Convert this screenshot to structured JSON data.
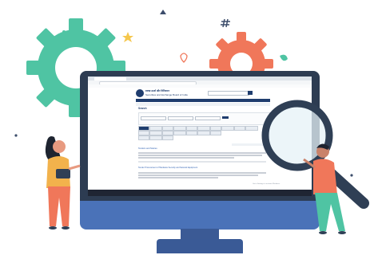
{
  "website": {
    "logo_text_line1": "स्वच्छ ऊर्जा और विनियमन",
    "logo_text_line2": "Securities and Exchange Board of India",
    "page_heading": "Search",
    "section_heading": "Tenders and Notices",
    "result_title": "Tender Procurement of Hardware Security and Network Equipment",
    "watermark": "Go to Settings to activate Windows."
  },
  "colors": {
    "gear_green": "#4fc4a3",
    "gear_orange": "#f0775a",
    "monitor_blue": "#4a72b8",
    "magnifier_dark": "#2f3f55",
    "site_nav": "#1f3d6e"
  },
  "icons": [
    "gear-icon",
    "magnifying-glass-icon",
    "star-icon",
    "hash-icon",
    "leaf-icon",
    "pin-icon"
  ]
}
